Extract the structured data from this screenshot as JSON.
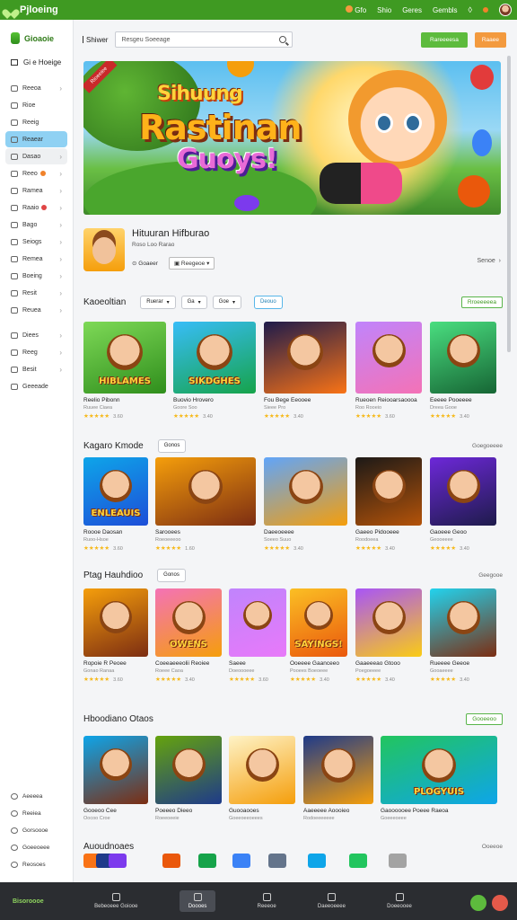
{
  "app": {
    "title": "Pjloeing"
  },
  "topbar": {
    "nav": [
      "Gfo",
      "Shio",
      "Geres",
      "Gembls"
    ]
  },
  "sidebar": {
    "brand": "Gioaoie",
    "home": "Gi e Hoeige",
    "items": [
      {
        "label": "Reeoa",
        "chevron": true
      },
      {
        "label": "Rioe"
      },
      {
        "label": "Reeig"
      },
      {
        "label": "Reaear",
        "active": true
      },
      {
        "label": "Dasao",
        "chevron": true,
        "hl": true
      },
      {
        "label": "Reeo",
        "chevron": true,
        "badge": "#f0822a"
      },
      {
        "label": "Ramea",
        "chevron": true
      },
      {
        "label": "Raaio",
        "chevron": true,
        "badge": "#e04545"
      },
      {
        "label": "Bago",
        "chevron": true
      },
      {
        "label": "Seiogs",
        "chevron": true
      },
      {
        "label": "Remea",
        "chevron": true
      },
      {
        "label": "Boeing",
        "chevron": true
      },
      {
        "label": "Resit",
        "chevron": true
      },
      {
        "label": "Reuea",
        "chevron": true
      }
    ],
    "items2": [
      {
        "label": "Diees",
        "chevron": true
      },
      {
        "label": "Reeg",
        "chevron": true
      },
      {
        "label": "Besit",
        "chevron": true
      },
      {
        "label": "Geeeade"
      }
    ],
    "bottom": [
      "Aeeeea",
      "Reeiea",
      "Gorsoooe",
      "Goeeoeee",
      "Reosoes"
    ]
  },
  "search": {
    "menu_label": "Shiwer",
    "placeholder": "Resgeu Soeeage",
    "primary_button": "Rareeeesa",
    "secondary_button": "Raaee"
  },
  "hero": {
    "ribbon": "Rioeeiee",
    "line1": "Sihuung",
    "line2": "Rastinan",
    "line3": "Guoys!"
  },
  "featured": {
    "title": "Hituuran Hifburao",
    "subtitle": "Roso Loo Rarao",
    "option1": "Goaeer",
    "option2": "Reegeoe",
    "more": "Senoe"
  },
  "sections": [
    {
      "title": "Kaoeoltian",
      "filters": [
        "Ruerar",
        "Ga",
        "Goe"
      ],
      "action": "Deouo",
      "right": "Rroeeeeea",
      "games": [
        {
          "name": "Reelio Pibonn",
          "meta": "Ruuee Ciaea",
          "rating": "3.60",
          "label": "HIBLAMES"
        },
        {
          "name": "Buovio Hrovero",
          "meta": "Goore Soo",
          "rating": "3.40",
          "label": "SIKDGHES"
        },
        {
          "name": "Fou Bege Eeooee",
          "meta": "Sieee Pro",
          "rating": "3.40",
          "label": ""
        },
        {
          "name": "Rueoen Reiooarsaoooa",
          "meta": "Roo Rooeio",
          "rating": "3.60",
          "label": ""
        },
        {
          "name": "Eeeee Pooeeee",
          "meta": "Dreea Gooe",
          "rating": "3.40",
          "label": ""
        }
      ]
    },
    {
      "title": "Kagaro Kmode",
      "pill": "Gonos",
      "right": "Goegoeeee",
      "games": [
        {
          "name": "Roooe Daosan",
          "meta": "Ruoo-Hsoe",
          "rating": "3.60",
          "label": "ENLEAUIS"
        },
        {
          "name": "Sarooees",
          "meta": "Roeoeeeoo",
          "rating": "1.60",
          "label": ""
        },
        {
          "name": "Daeeoeeee",
          "meta": "Soeeo Suuo",
          "rating": "3.40",
          "label": ""
        },
        {
          "name": "Gaeeo Pidooeee",
          "meta": "Roodoeea",
          "rating": "3.40",
          "label": ""
        },
        {
          "name": "Gaoeee Geoo",
          "meta": "Geooeeee",
          "rating": "3.40",
          "label": ""
        }
      ]
    },
    {
      "title": "Ptag Hauhdioo",
      "pill": "Gonos",
      "right": "Geegooe",
      "games": [
        {
          "name": "Ropoie R Peoee",
          "meta": "Gonao Ranaa",
          "rating": "3.60",
          "label": ""
        },
        {
          "name": "Coeeaeeeolii Reoiee",
          "meta": "Roeee Caoa",
          "rating": "3.40",
          "label": "OWENS"
        },
        {
          "name": "Saeee",
          "meta": "Doeoooeee",
          "rating": "3.60",
          "label": ""
        },
        {
          "name": "Ooeeee Gaanceeo",
          "meta": "Pooees Boeoeee",
          "rating": "3.40",
          "label": "SAYINGS!"
        },
        {
          "name": "Gaaeeeao Gtooo",
          "meta": "Poegoeeee",
          "rating": "3.40",
          "label": ""
        },
        {
          "name": "Rueeee Geeoe",
          "meta": "Gooaeeee",
          "rating": "3.40",
          "label": ""
        }
      ]
    },
    {
      "title": "Hboodiano Otaos",
      "right": "Gooeeoo",
      "games": [
        {
          "name": "Gooeoo Cee",
          "meta": "Oocoo Croe",
          "rating": "",
          "label": ""
        },
        {
          "name": "Poeeeo Dieeo",
          "meta": "Roeeoeeie",
          "rating": "",
          "label": ""
        },
        {
          "name": "Guooaooes",
          "meta": "Goeeoeeoeees",
          "rating": "",
          "label": ""
        },
        {
          "name": "Aaeeeee Aoooieo",
          "meta": "Rodoeeeeeee",
          "rating": "",
          "label": ""
        },
        {
          "name": "Gaoooooee Poeee Raeoa",
          "meta": "Goeeeoeee",
          "rating": "",
          "label": "PLOGYUIS"
        }
      ]
    }
  ],
  "recent": {
    "title": "Auoudnoaes",
    "right": "Ooeeoe"
  },
  "bottombar": {
    "brand": "Bisoroooe",
    "items": [
      "Bebeoeee Goiooe",
      "Doooes",
      "Reeeoe",
      "Daeeoeeee",
      "Doeeooee"
    ],
    "active_index": 1
  },
  "colors": {
    "brand": "#3f9a22",
    "accent_orange": "#f39a3e",
    "star": "#f6b91a",
    "active_nav": "#8fd1f3"
  }
}
